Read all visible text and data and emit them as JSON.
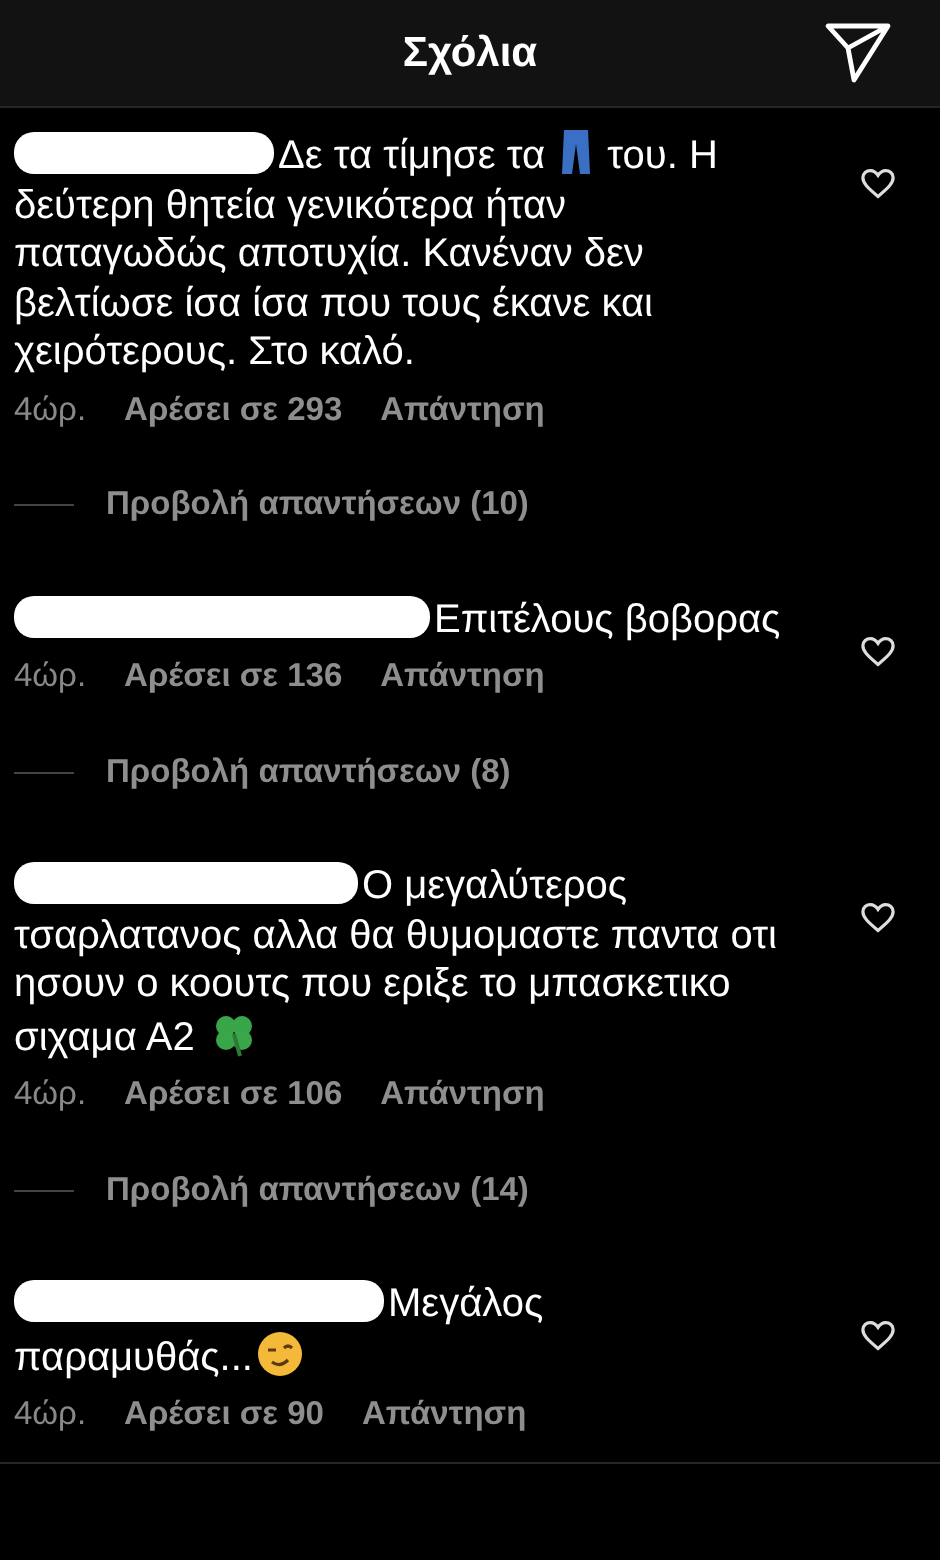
{
  "header": {
    "title": "Σχόλια"
  },
  "comments": [
    {
      "segments": [
        {
          "kind": "redacted"
        },
        {
          "kind": "text",
          "text": "Δε τα τίμησε τα "
        },
        {
          "kind": "jeans"
        },
        {
          "kind": "text",
          "text": " του. Η δεύτερη θητεία γενικότερα ήταν παταγωδώς αποτυχία. Κανέναν δεν βελτίωσε ίσα ίσα που τους έκανε και χειρότερους.  Στο καλό."
        }
      ],
      "time": "4ώρ.",
      "likes": "Αρέσει σε 293",
      "reply": "Απάντηση",
      "replies": "Προβολή απαντήσεων (10)"
    },
    {
      "segments": [
        {
          "kind": "redacted"
        },
        {
          "kind": "text",
          "text": "Επιτέλους βοβορας"
        }
      ],
      "time": "4ώρ.",
      "likes": "Αρέσει σε 136",
      "reply": "Απάντηση",
      "replies": "Προβολή απαντήσεων (8)"
    },
    {
      "segments": [
        {
          "kind": "redacted"
        },
        {
          "kind": "text",
          "text": "Ο μεγαλύτερος τσαρλατανος αλλα θα θυμομαστε παντα οτι ησουν ο κοουτς που εριξε το μπασκετικο σιχαμα Α2 "
        },
        {
          "kind": "clover"
        }
      ],
      "time": "4ώρ.",
      "likes": "Αρέσει σε 106",
      "reply": "Απάντηση",
      "replies": "Προβολή απαντήσεων (14)"
    },
    {
      "segments": [
        {
          "kind": "redacted"
        },
        {
          "kind": "text",
          "text": "Μεγάλος παραμυθάς..."
        },
        {
          "kind": "wink"
        }
      ],
      "time": "4ώρ.",
      "likes": "Αρέσει σε 90",
      "reply": "Απάντηση"
    }
  ]
}
